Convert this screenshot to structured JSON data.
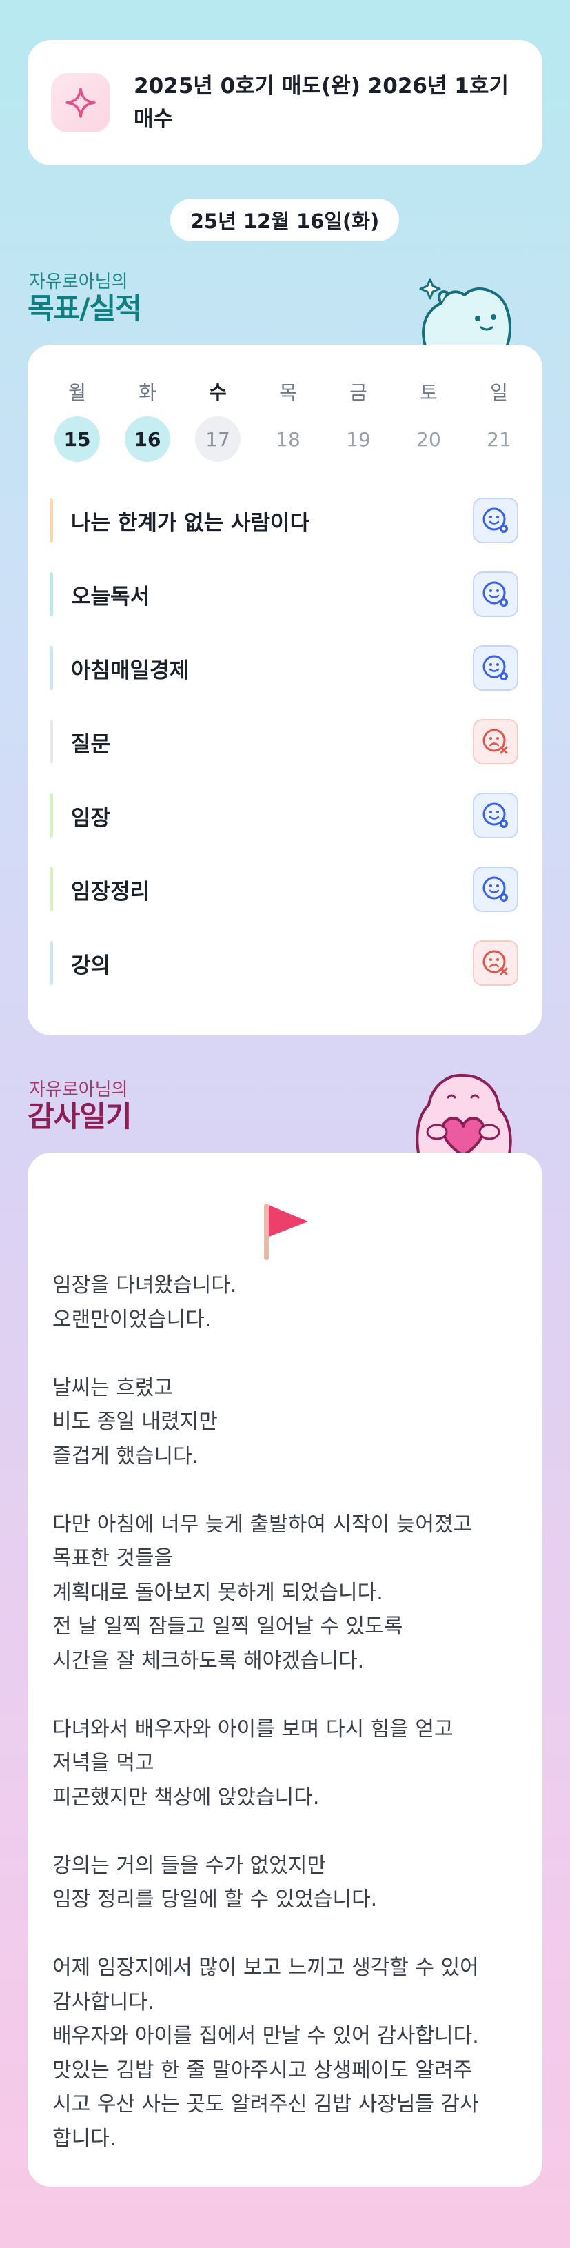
{
  "goal": {
    "icon": "sparkle-icon",
    "text": "2025년 0호기 매도(완) 2026년 1호기 매수"
  },
  "date": "25년 12월 16일(화)",
  "achievements": {
    "owner_label": "자유로아님의",
    "title": "목표/실적",
    "week": [
      {
        "name": "월",
        "num": "15",
        "state": "done"
      },
      {
        "name": "화",
        "num": "16",
        "state": "done"
      },
      {
        "name": "수",
        "num": "17",
        "state": "today"
      },
      {
        "name": "목",
        "num": "18",
        "state": "future"
      },
      {
        "name": "금",
        "num": "19",
        "state": "future"
      },
      {
        "name": "토",
        "num": "20",
        "state": "future"
      },
      {
        "name": "일",
        "num": "21",
        "state": "future"
      }
    ],
    "habits": [
      {
        "label": "나는 한계가 없는 사람이다",
        "status": "done",
        "color": "#f7d9b4"
      },
      {
        "label": "오늘독서",
        "status": "done",
        "color": "#bfe9e4"
      },
      {
        "label": "아침매일경제",
        "status": "done",
        "color": "#cfe4f5"
      },
      {
        "label": "질문",
        "status": "failed",
        "color": "#e8e9ec"
      },
      {
        "label": "임장",
        "status": "done",
        "color": "#d8f0c4"
      },
      {
        "label": "임장정리",
        "status": "done",
        "color": "#d8f0c4"
      },
      {
        "label": "강의",
        "status": "failed",
        "color": "#cfe4f5"
      }
    ]
  },
  "gratitude": {
    "owner_label": "자유로아님의",
    "title": "감사일기",
    "flag_icon": "red-flag-icon",
    "text": "임장을 다녀왔습니다.\n오랜만이었습니다.\n\n날씨는 흐렸고\n비도 종일 내렸지만\n즐겁게 했습니다.\n\n다만 아침에 너무 늦게 출발하여 시작이 늦어졌고\n목표한 것들을\n계획대로 돌아보지 못하게 되었습니다.\n전 날 일찍 잠들고 일찍 일어날 수 있도록\n시간을 잘 체크하도록 해야겠습니다.\n\n다녀와서 배우자와 아이를 보며 다시 힘을 얻고\n저녁을 먹고\n피곤했지만 책상에 앉았습니다.\n\n강의는 거의 들을 수가 없었지만\n임장 정리를 당일에 할 수 있었습니다.\n\n어제 임장지에서 많이 보고 느끼고 생각할 수 있어\n감사합니다.\n배우자와 아이를 집에서 만날 수 있어 감사합니다.\n맛있는 김밥 한 줄 말아주시고 상생페이도 알려주\n시고 우산 사는 곳도 알려주신 김밥 사장님들 감사\n합니다."
  },
  "colors": {
    "done_icon": "#3a62e6",
    "fail_icon": "#e2544a",
    "accent_teal": "#0e7f7e",
    "accent_plum": "#8e1f56",
    "flag": "#ec3f6b"
  }
}
